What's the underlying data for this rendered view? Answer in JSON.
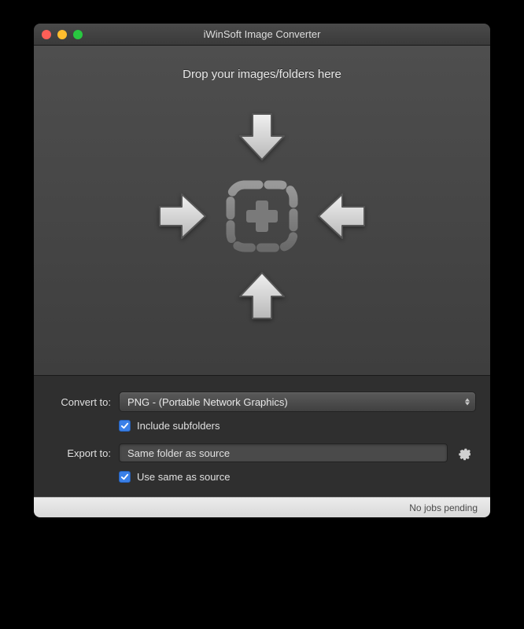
{
  "window": {
    "title": "iWinSoft Image Converter"
  },
  "drop": {
    "prompt": "Drop your images/folders here"
  },
  "controls": {
    "convert_label": "Convert to:",
    "convert_value": "PNG - (Portable Network Graphics)",
    "include_subfolders_label": "Include subfolders",
    "include_subfolders_checked": true,
    "export_label": "Export to:",
    "export_value": "Same folder as source",
    "use_same_as_source_label": "Use same as source",
    "use_same_as_source_checked": true
  },
  "status": {
    "text": "No jobs pending"
  }
}
